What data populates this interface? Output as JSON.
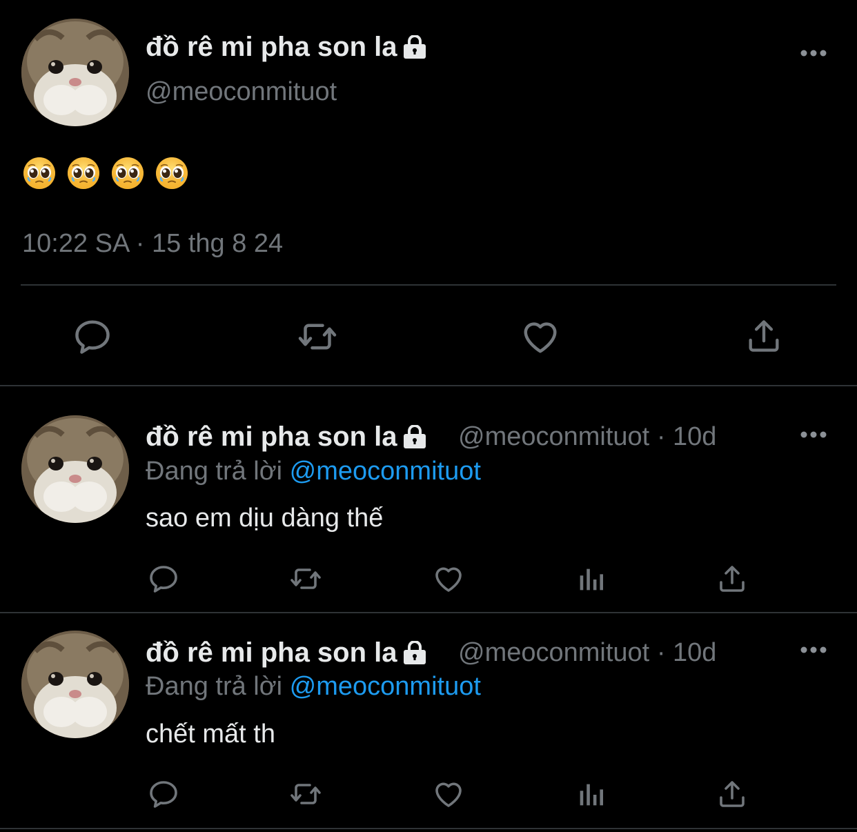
{
  "main_tweet": {
    "display_name": "đồ rê mi pha son la",
    "handle": "@meoconmituot",
    "content_emoji": [
      "🥹",
      "🥹",
      "🥹",
      "🥹"
    ],
    "timestamp": "10:22 SA · 15 thg 8 24"
  },
  "replies": [
    {
      "display_name": "đồ rê mi pha son la",
      "handle": "@meoconmituot",
      "separator": "·",
      "age": "10d",
      "replying_prefix": "Đang trả lời",
      "replying_to": "@meoconmituot",
      "text": "sao em dịu dàng thế"
    },
    {
      "display_name": "đồ rê mi pha son la",
      "handle": "@meoconmituot",
      "separator": "·",
      "age": "10d",
      "replying_prefix": "Đang trả lời",
      "replying_to": "@meoconmituot",
      "text": "chết mất th"
    }
  ],
  "colors": {
    "background": "#000000",
    "primary_text": "#e7e9ea",
    "secondary_text": "#71767b",
    "accent": "#1d9bf0",
    "divider": "#2f3336"
  },
  "icons": {
    "lock": "lock-icon",
    "more": "more-dots-icon",
    "reply": "reply-bubble-icon",
    "retweet": "retweet-icon",
    "like": "heart-icon",
    "views": "analytics-bars-icon",
    "share": "share-upload-icon"
  }
}
